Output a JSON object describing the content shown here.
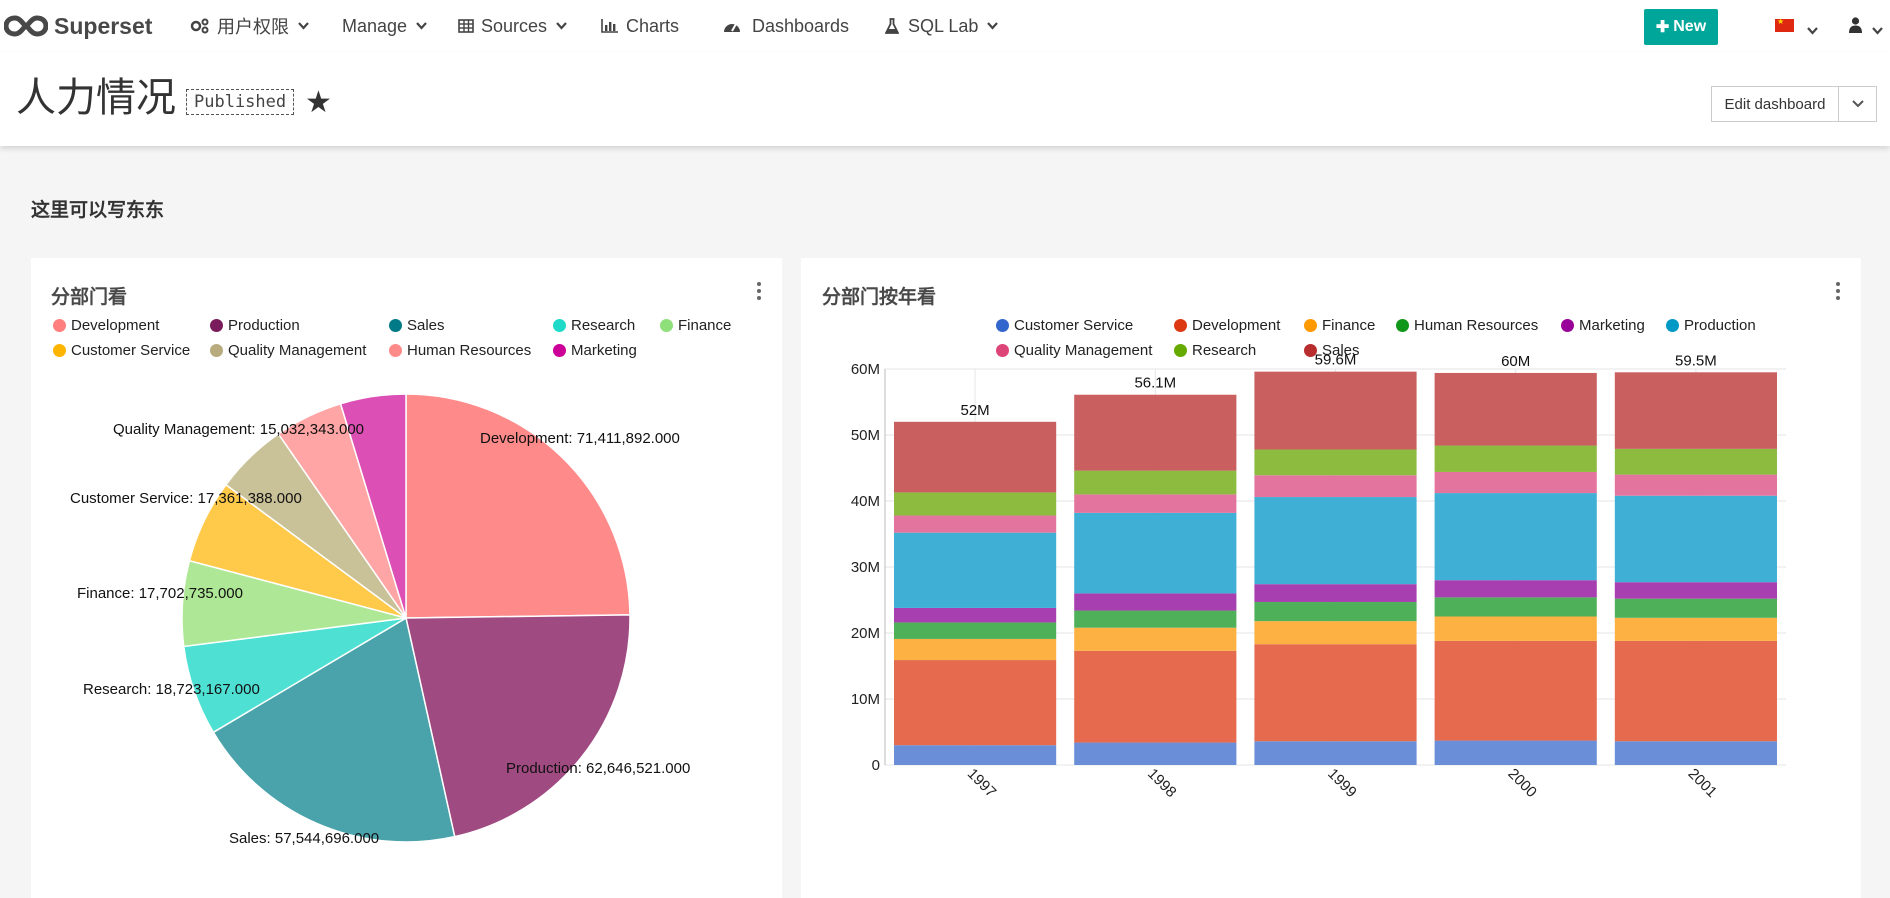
{
  "navbar": {
    "brand": "Superset",
    "items": [
      {
        "label": "用户权限",
        "icon": "gears-icon",
        "has_caret": true
      },
      {
        "label": "Manage",
        "icon": "",
        "has_caret": true
      },
      {
        "label": "Sources",
        "icon": "table-icon",
        "has_caret": true
      },
      {
        "label": "Charts",
        "icon": "bar-chart-icon",
        "has_caret": false
      },
      {
        "label": "Dashboards",
        "icon": "dashboard-gauge-icon",
        "has_caret": false
      },
      {
        "label": "SQL Lab",
        "icon": "flask-icon",
        "has_caret": true
      }
    ],
    "new_button": "New",
    "language_flag": "china-flag-icon",
    "user_icon": "user-icon"
  },
  "dashboard": {
    "title": "人力情况",
    "status_badge": "Published",
    "edit_button": "Edit dashboard",
    "markdown_text": "这里可以写东东"
  },
  "pie_card": {
    "title": "分部门看",
    "legend": [
      {
        "name": "Development",
        "color": "#ff7f7f"
      },
      {
        "name": "Production",
        "color": "#7a1c5b"
      },
      {
        "name": "Sales",
        "color": "#007a87"
      },
      {
        "name": "Research",
        "color": "#1fdac9"
      },
      {
        "name": "Finance",
        "color": "#8fe07a"
      },
      {
        "name": "Customer Service",
        "color": "#ffb400"
      },
      {
        "name": "Quality Management",
        "color": "#b8ab7e"
      },
      {
        "name": "Human Resources",
        "color": "#ff8a8a"
      },
      {
        "name": "Marketing",
        "color": "#cc0099"
      }
    ]
  },
  "bar_card": {
    "title": "分部门按年看",
    "legend": [
      {
        "name": "Customer Service",
        "color": "#3366cc"
      },
      {
        "name": "Development",
        "color": "#dc3912"
      },
      {
        "name": "Finance",
        "color": "#ff9900"
      },
      {
        "name": "Human Resources",
        "color": "#109618"
      },
      {
        "name": "Marketing",
        "color": "#990099"
      },
      {
        "name": "Production",
        "color": "#0099c6"
      },
      {
        "name": "Quality Management",
        "color": "#dd4477"
      },
      {
        "name": "Research",
        "color": "#66aa00"
      },
      {
        "name": "Sales",
        "color": "#b82e2e"
      }
    ]
  },
  "chart_data": [
    {
      "type": "pie",
      "title": "分部门看",
      "slices": [
        {
          "label": "Development",
          "value": 71411892,
          "display": "Development: 71,411,892.000",
          "color": "#ff8a8a"
        },
        {
          "label": "Production",
          "value": 62646521,
          "display": "Production: 62,646,521.000",
          "color": "#a04a82"
        },
        {
          "label": "Sales",
          "value": 57544696,
          "display": "Sales: 57,544,696.000",
          "color": "#4aa2ab"
        },
        {
          "label": "Research",
          "value": 18723167,
          "display": "Research: 18,723,167.000",
          "color": "#4fe0d4"
        },
        {
          "label": "Finance",
          "value": 17702735,
          "display": "Finance: 17,702,735.000",
          "color": "#aee896"
        },
        {
          "label": "Customer Service",
          "value": 17361388,
          "display": "Customer Service: 17,361,388.000",
          "color": "#ffc94a"
        },
        {
          "label": "Quality Management",
          "value": 15032343,
          "display": "Quality Management: 15,032,343.000",
          "color": "#c9c197"
        },
        {
          "label": "Human Resources",
          "value": 14200000,
          "display": "",
          "color": "#ffa5a5"
        },
        {
          "label": "Marketing",
          "value": 13600000,
          "display": "",
          "color": "#dc4fb4"
        }
      ]
    },
    {
      "type": "bar",
      "title": "分部门按年看",
      "stacked": true,
      "categories": [
        "1997",
        "1998",
        "1999",
        "2000",
        "2001"
      ],
      "ylim": [
        0,
        60000000
      ],
      "yticks": [
        {
          "value": 0,
          "label": "0"
        },
        {
          "value": 10000000,
          "label": "10M"
        },
        {
          "value": 20000000,
          "label": "20M"
        },
        {
          "value": 30000000,
          "label": "30M"
        },
        {
          "value": 40000000,
          "label": "40M"
        },
        {
          "value": 50000000,
          "label": "50M"
        },
        {
          "value": 60000000,
          "label": "60M"
        }
      ],
      "totals": [
        "52M",
        "56.1M",
        "59.6M",
        "60M",
        "59.5M"
      ],
      "series": [
        {
          "name": "Customer Service",
          "color": "#6a8fd8",
          "values": [
            3000000,
            3400000,
            3600000,
            3700000,
            3600000
          ]
        },
        {
          "name": "Development",
          "color": "#e66b4e",
          "values": [
            12900000,
            13900000,
            14700000,
            15100000,
            15200000
          ]
        },
        {
          "name": "Finance",
          "color": "#fdb143",
          "values": [
            3200000,
            3500000,
            3500000,
            3700000,
            3500000
          ]
        },
        {
          "name": "Human Resources",
          "color": "#4fb05a",
          "values": [
            2500000,
            2600000,
            2900000,
            2900000,
            2900000
          ]
        },
        {
          "name": "Marketing",
          "color": "#a83fb0",
          "values": [
            2200000,
            2600000,
            2700000,
            2600000,
            2500000
          ]
        },
        {
          "name": "Production",
          "color": "#3fafd5",
          "values": [
            11400000,
            12200000,
            13200000,
            13200000,
            13100000
          ]
        },
        {
          "name": "Quality Management",
          "color": "#e2749e",
          "values": [
            2600000,
            2800000,
            3300000,
            3200000,
            3200000
          ]
        },
        {
          "name": "Research",
          "color": "#8dbb40",
          "values": [
            3500000,
            3600000,
            3900000,
            4000000,
            3900000
          ]
        },
        {
          "name": "Sales",
          "color": "#c95f5f",
          "values": [
            10700000,
            11500000,
            11800000,
            11000000,
            11600000
          ]
        }
      ]
    }
  ]
}
